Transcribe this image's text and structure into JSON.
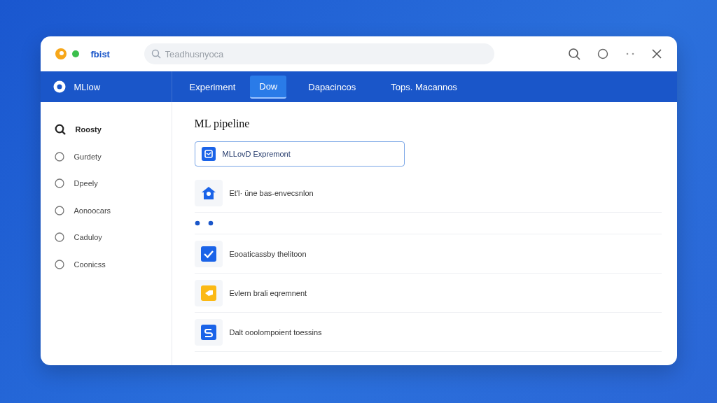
{
  "app": {
    "name": "fbist"
  },
  "search": {
    "placeholder": "Teadhusnyoca"
  },
  "nav": {
    "brand": "MLlow",
    "tabs": [
      {
        "label": "Experiment",
        "selected": false
      },
      {
        "label": "Dow",
        "selected": true
      },
      {
        "label": "Dapacincos",
        "selected": false
      },
      {
        "label": "Tops. Macannos",
        "selected": false
      }
    ]
  },
  "sidebar": {
    "items": [
      {
        "kind": "search",
        "label": "Roosty"
      },
      {
        "kind": "radio",
        "label": "Gurdety"
      },
      {
        "kind": "radio",
        "label": "Dpeely"
      },
      {
        "kind": "radio",
        "label": "Aonoocars"
      },
      {
        "kind": "radio",
        "label": "Caduloy"
      },
      {
        "kind": "radio",
        "label": "Coonicss"
      }
    ]
  },
  "content": {
    "title": "ML pipeline",
    "items": [
      {
        "kind": "item",
        "color": "#1a63e8",
        "label": "MLLovD Expremont",
        "selected": true
      },
      {
        "kind": "item",
        "color": "#1a63e8",
        "label": "Et'l· üne bas-envecsnlon",
        "selected": false
      },
      {
        "kind": "dots",
        "selected": false
      },
      {
        "kind": "item",
        "color": "#1a63e8",
        "label": "Eooaticassby thelitoon",
        "selected": false
      },
      {
        "kind": "item",
        "color": "#fbb915",
        "label": "Evlern brali eqremnent",
        "selected": false
      },
      {
        "kind": "item",
        "color": "#1a63e8",
        "label": "Dalt ooolompoient toessins",
        "selected": false
      }
    ]
  }
}
